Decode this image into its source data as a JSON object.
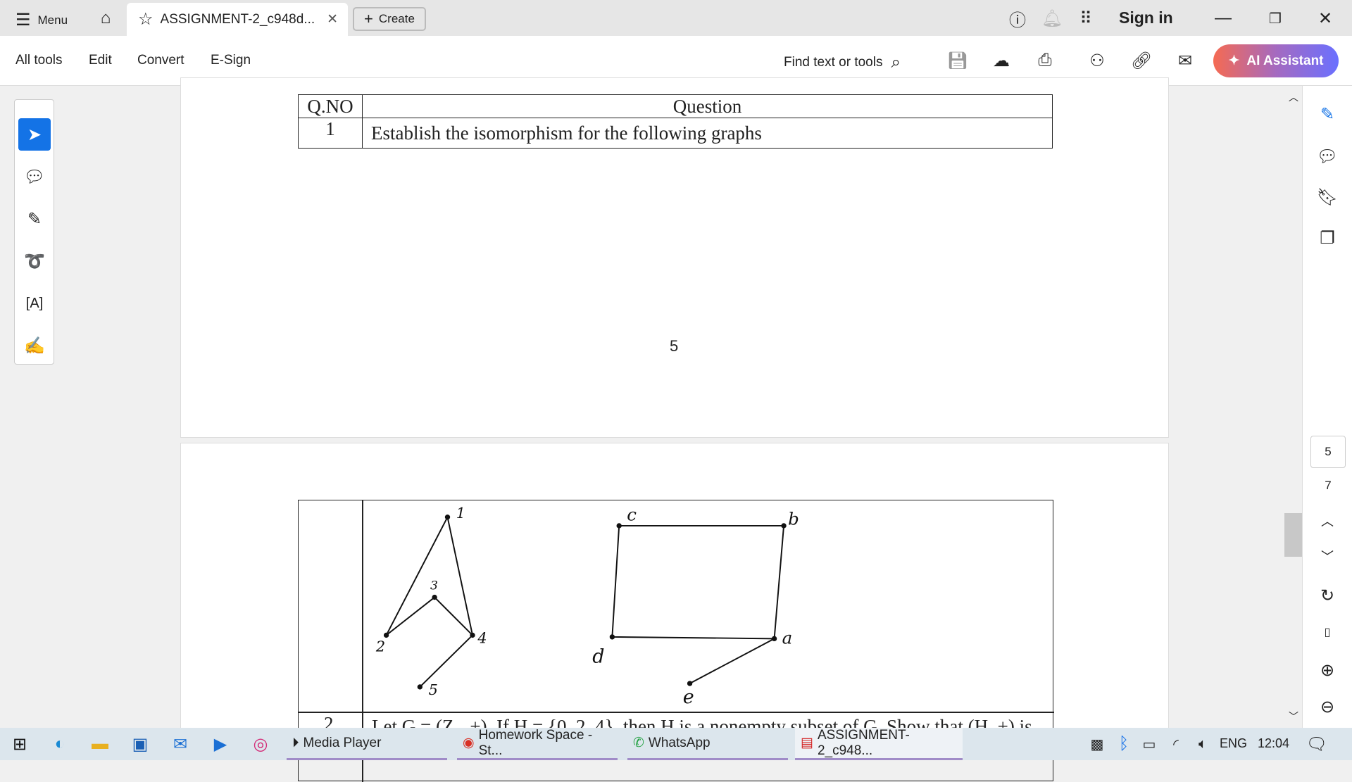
{
  "titlebar": {
    "menu": "Menu",
    "tab_title": "ASSIGNMENT-2_c948d...",
    "create": "Create",
    "sign_in": "Sign in"
  },
  "toolbar": {
    "items": [
      "All tools",
      "Edit",
      "Convert",
      "E-Sign"
    ],
    "find": "Find text or tools",
    "ai_assistant": "AI Assistant"
  },
  "document": {
    "table1": {
      "headers": [
        "Q.NO",
        "Question"
      ],
      "rows": [
        [
          "1",
          "Establish the isomorphism for the following graphs"
        ]
      ]
    },
    "page_number": "5",
    "graph_left_labels": [
      "1",
      "3",
      "2",
      "4",
      "5"
    ],
    "graph_right_labels": [
      "c",
      "b",
      "d",
      "a",
      "e"
    ],
    "next_row": {
      "qno": "2",
      "text": "Let G = (Z₆, +). If H = {0, 2, 4}, then H is a nonempty subset of G. Show that (H, +) is"
    }
  },
  "right_panel": {
    "current_page": "5",
    "total_pages": "7"
  },
  "taskbar": {
    "apps": [
      "Media Player",
      "Homework Space - St...",
      "WhatsApp",
      "ASSIGNMENT-2_c948..."
    ],
    "lang": "ENG",
    "time": "12:04"
  },
  "colors": {
    "accent": "#1473e6",
    "ai_gradient_start": "#f56a52",
    "ai_gradient_end": "#6a70ff"
  }
}
